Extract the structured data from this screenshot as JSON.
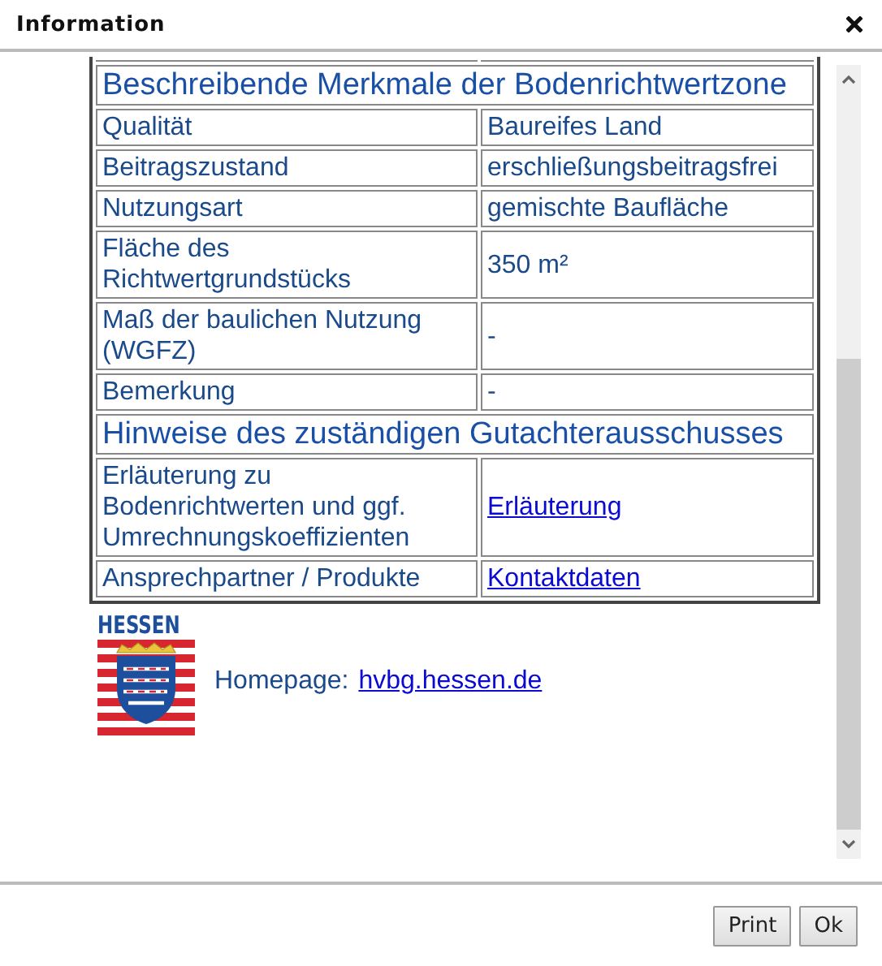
{
  "window": {
    "title": "Information"
  },
  "sections": [
    {
      "heading": "Beschreibende Merkmale der Bodenrichtwertzone",
      "rows": [
        {
          "label": "Qualität",
          "value": "Baureifes Land",
          "kind": "text"
        },
        {
          "label": "Beitragszustand",
          "value": "erschließungsbeitragsfrei",
          "kind": "text"
        },
        {
          "label": "Nutzungsart",
          "value": "gemischte Baufläche",
          "kind": "text"
        },
        {
          "label": "Fläche des Richtwertgrundstücks",
          "value": "350 m²",
          "kind": "text"
        },
        {
          "label": "Maß der baulichen Nutzung (WGFZ)",
          "value": "-",
          "kind": "text"
        },
        {
          "label": "Bemerkung",
          "value": "-",
          "kind": "text"
        }
      ]
    },
    {
      "heading": "Hinweise des zuständigen Gutachterausschusses",
      "rows": [
        {
          "label": "Erläuterung zu Bodenrichtwerten und ggf. Umrechnungskoeffizienten",
          "value": "Erläuterung",
          "kind": "link"
        },
        {
          "label": "Ansprechpartner / Produkte",
          "value": "Kontaktdaten",
          "kind": "link"
        }
      ]
    }
  ],
  "logo": {
    "name": "HESSEN"
  },
  "homepage": {
    "label": "Homepage:",
    "link": "hvbg.hessen.de"
  },
  "buttons": [
    "Print",
    "Ok"
  ]
}
